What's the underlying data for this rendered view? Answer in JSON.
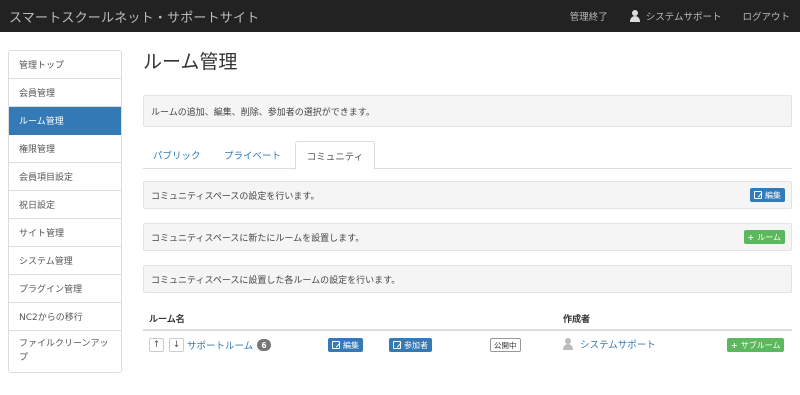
{
  "navbar": {
    "brand": "スマートスクールネット・サポートサイト",
    "links": {
      "admin_exit": "管理終了",
      "system_support": "システムサポート",
      "logout": "ログアウト"
    }
  },
  "sidebar": {
    "items": [
      {
        "label": "管理トップ"
      },
      {
        "label": "会員管理"
      },
      {
        "label": "ルーム管理",
        "active": true
      },
      {
        "label": "権限管理"
      },
      {
        "label": "会員項目設定"
      },
      {
        "label": "祝日設定"
      },
      {
        "label": "サイト管理"
      },
      {
        "label": "システム管理"
      },
      {
        "label": "プラグイン管理"
      },
      {
        "label": "NC2からの移行"
      },
      {
        "label": "ファイルクリーンアップ"
      }
    ]
  },
  "main": {
    "title": "ルーム管理",
    "description": "ルームの追加、編集、削除、参加者の選択ができます。",
    "tabs": [
      {
        "label": "パブリック"
      },
      {
        "label": "プライベート"
      },
      {
        "label": "コミュニティ",
        "active": true
      }
    ],
    "space_settings": {
      "text": "コミュニティスペースの設定を行います。",
      "button": "編集"
    },
    "add_room": {
      "text": "コミュニティスペースに新たにルームを設置します。",
      "button": "ルーム"
    },
    "room_settings": {
      "text": "コミュニティスペースに設置した各ルームの設定を行います。"
    }
  },
  "table": {
    "headers": {
      "room_name": "ルーム名",
      "creator": "作成者"
    },
    "rows": [
      {
        "room_name": "サポートルーム",
        "count": "6",
        "edit": "編集",
        "members": "参加者",
        "status": "公開中",
        "creator": "システムサポート",
        "subroom": "サブルーム"
      }
    ]
  },
  "colors": {
    "primary": "#337ab7",
    "success": "#5cb85c",
    "navbar": "#222222",
    "badge": "#777777"
  }
}
